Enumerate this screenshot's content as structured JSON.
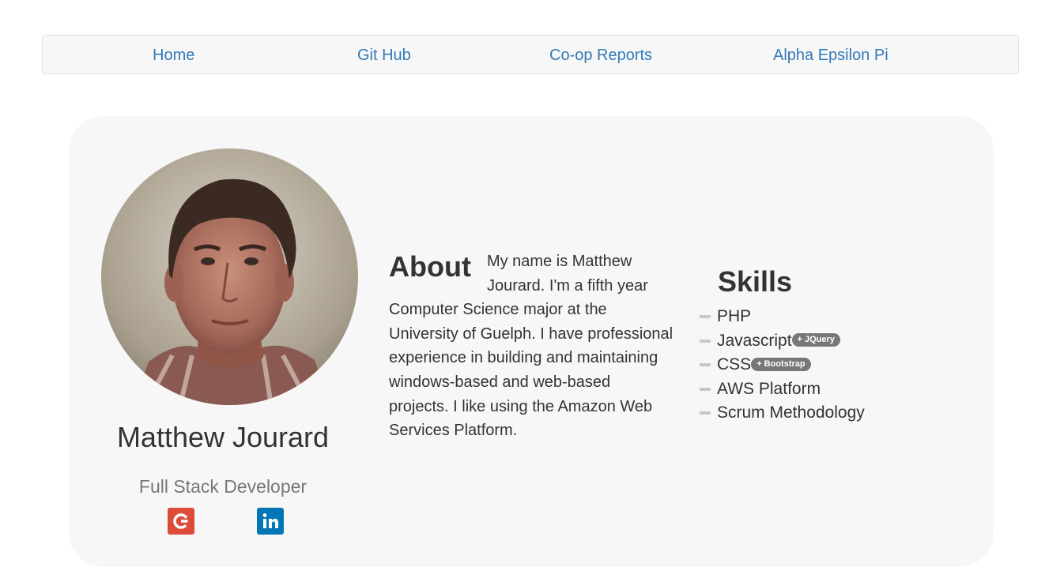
{
  "nav": {
    "items": [
      {
        "label": "Home"
      },
      {
        "label": "Git Hub"
      },
      {
        "label": "Co-op Reports"
      },
      {
        "label": "Alpha Epsilon Pi"
      }
    ]
  },
  "profile": {
    "name": "Matthew Jourard",
    "role": "Full Stack Developer"
  },
  "social": {
    "google_glyph": "G",
    "linkedin_glyph": "in",
    "google_color": "#dd4b39",
    "linkedin_color": "#0077b5"
  },
  "about": {
    "heading": "About",
    "text": "My name is Matthew Jourard. I'm a fifth year Computer Science major at the University of Guelph. I have professional experience in building and maintaining windows-based and web-based projects. I like using the Amazon Web Services Platform."
  },
  "skills": {
    "heading": "Skills",
    "items": [
      {
        "label": "PHP",
        "badge": ""
      },
      {
        "label": "Javascript",
        "badge": "+ JQuery"
      },
      {
        "label": "CSS",
        "badge": "+ Bootstrap"
      },
      {
        "label": "AWS Platform",
        "badge": ""
      },
      {
        "label": "Scrum Methodology",
        "badge": ""
      }
    ]
  },
  "colors": {
    "link": "#337ab7",
    "card_bg": "#f7f7f7",
    "badge_bg": "#777777"
  }
}
